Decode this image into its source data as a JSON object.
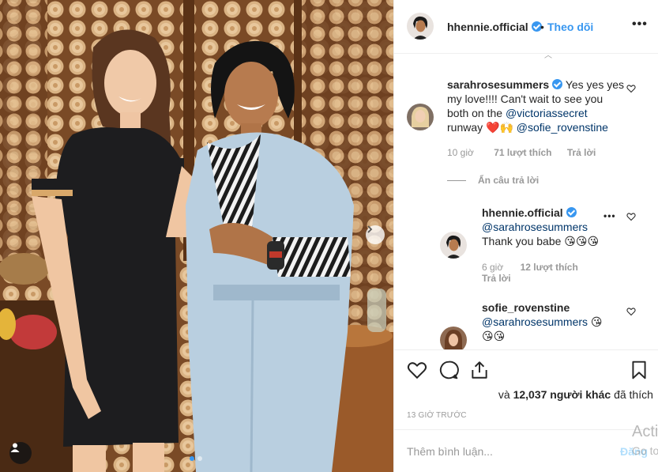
{
  "header": {
    "username": "hhennie.official",
    "separator": "•",
    "follow_label": "Theo dõi",
    "more_label": "•••"
  },
  "comments": [
    {
      "username": "sarahrosesummers",
      "text_1": "Yes yes yes my love!!!! Can't wait to see you both on the",
      "mention_1": "@victoriassecret",
      "text_2": "runway ❤️🙌",
      "mention_2": "@sofie_rovenstine",
      "time": "10 giờ",
      "likes": "71 lượt thích",
      "reply_label": "Trả lời"
    }
  ],
  "hide_replies_label": "Ẩn câu trả lời",
  "replies": [
    {
      "username": "hhennie.official",
      "mention": "@sarahrosesummers",
      "text": "Thank you babe 😘😘😘",
      "time": "6 giờ",
      "likes": "12 lượt thích",
      "reply_label": "Trả lời",
      "more_label": "•••"
    },
    {
      "username": "sofie_rovenstine",
      "mention": "@sarahrosesummers",
      "text_inline": "😘",
      "text_2": "😘😘"
    }
  ],
  "actions": {
    "likes_suffix": "và",
    "likes_count": "12,037 người khác",
    "likes_tail": "đã thích",
    "timestamp": "13 GIỜ TRƯỚC"
  },
  "add_comment": {
    "placeholder": "Thêm bình luận...",
    "post_label": "Đăng"
  },
  "watermark": {
    "line1": "Acti",
    "line2": "Go to"
  },
  "colors": {
    "accent": "#3897f0",
    "text": "#262626",
    "muted": "#999999",
    "border": "#efefef"
  }
}
